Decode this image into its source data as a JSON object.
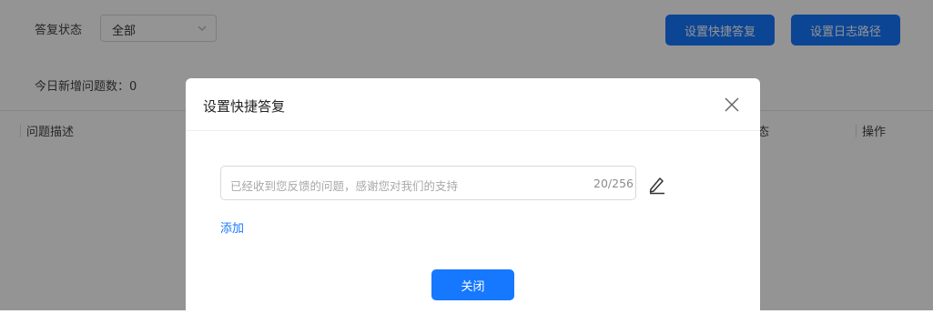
{
  "filter": {
    "label": "答复状态",
    "select_value": "全部",
    "chevron_icon": "chevron-down-icon"
  },
  "toolbar": {
    "quick_reply_label": "设置快捷答复",
    "log_path_label": "设置日志路径"
  },
  "stats": {
    "new_today": "今日新增问题数：0"
  },
  "table": {
    "columns": [
      "问题描述",
      "态",
      "操作"
    ]
  },
  "modal": {
    "title": "设置快捷答复",
    "close_icon": "close-icon",
    "reply_placeholder": "已经收到您反馈的问题，感谢您对我们的支持",
    "reply_counter": "20/256",
    "edit_icon": "pencil-icon",
    "add_label": "添加",
    "close_button_label": "关闭"
  },
  "colors": {
    "primary": "#1677ff",
    "overlay": "rgba(0,0,0,0.42)"
  }
}
